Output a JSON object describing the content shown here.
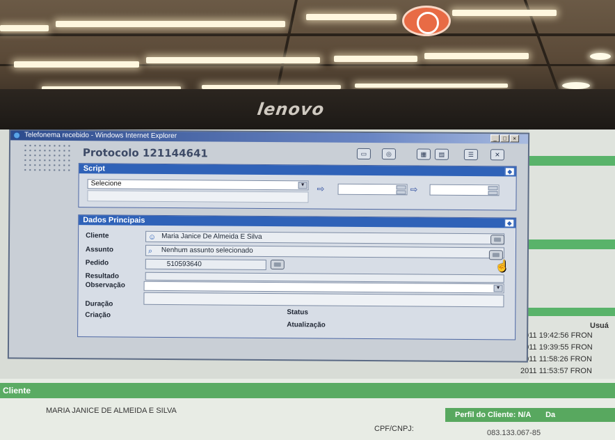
{
  "environment": {
    "monitor_brand": "lenovo"
  },
  "dialog": {
    "window_title": "Telefonema recebido - Windows Internet Explorer",
    "protocol_title": "Protocolo 121144641",
    "script_section": {
      "header": "Script",
      "select_value": "Selecione"
    },
    "main_section": {
      "header": "Dados Principais",
      "cliente_label": "Cliente",
      "cliente_value": "Maria Janice De Almeida E Silva",
      "assunto_label": "Assunto",
      "assunto_value": "Nenhum assunto selecionado",
      "pedido_label": "Pedido",
      "pedido_value": "510593640",
      "resultado_label": "Resultado",
      "observacao_label": "Observação",
      "duracao_label": "Duração",
      "criacao_label": "Criação",
      "status_label": "Status",
      "atualizacao_label": "Atualização"
    }
  },
  "background_app": {
    "usuario_header": "Usuá",
    "log_rows": [
      "2011 19:42:56 FRON",
      "2011 19:39:55 FRON",
      "2011 11:58:26 FRON",
      "2011 11:53:57 FRON"
    ],
    "cliente_bar": "Cliente",
    "customer_name": "MARIA JANICE DE ALMEIDA E SILVA",
    "perfil_text": "Perfil do Cliente: N/A",
    "perfil_extra": "Da",
    "cpf_label": "CPF/CNPJ:",
    "cpf_value": "083.133.067-85"
  },
  "colors": {
    "dialog_header_blue": "#2f62b8",
    "app_green": "#5aab63"
  }
}
